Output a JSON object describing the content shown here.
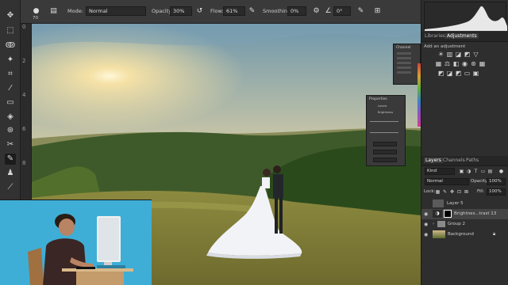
{
  "options_bar": {
    "brush_size": "70",
    "mode_label": "Mode:",
    "mode_value": "Normal",
    "opacity_label": "Opacity:",
    "opacity_value": "30%",
    "flow_label": "Flow:",
    "flow_value": "61%",
    "smoothing_label": "Smoothing:",
    "smoothing_value": "0%",
    "angle_value": "0°"
  },
  "ruler": {
    "marks": [
      "0",
      "2",
      "4",
      "6",
      "8"
    ]
  },
  "libraries_panel": {
    "tabs": [
      "Libraries",
      "Adjustments"
    ],
    "active_tab": "Adjustments",
    "heading": "Add an adjustment"
  },
  "color_swatch_panel": {
    "title": "Channel"
  },
  "properties_panel": {
    "title": "Properties",
    "line1": "Levels",
    "line2": "Brightness"
  },
  "layers_panel": {
    "tabs": [
      "Layers",
      "Channels",
      "Paths"
    ],
    "active_tab": "Layers",
    "kind_label": "Kind",
    "blend_mode": "Normal",
    "opacity_label": "Opacity:",
    "opacity_value": "100%",
    "lock_label": "Lock:",
    "fill_label": "Fill:",
    "fill_value": "100%",
    "layers": [
      {
        "name": "Layer 5",
        "visible": false,
        "selected": false
      },
      {
        "name": "Brightnes...trast 13",
        "visible": true,
        "selected": true
      },
      {
        "name": "Group 2",
        "visible": true,
        "selected": false
      },
      {
        "name": "Background",
        "visible": true,
        "selected": false
      }
    ]
  },
  "colors": {
    "panel_bg": "#2e2e2e",
    "toolbar_bg": "#323232",
    "webcam_bg": "#3faed6",
    "selected_layer": "#444444"
  }
}
